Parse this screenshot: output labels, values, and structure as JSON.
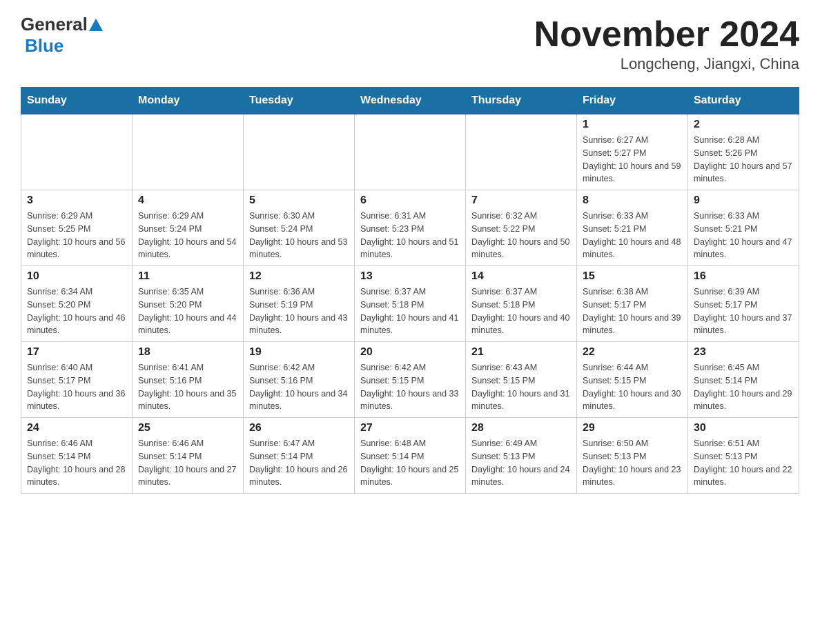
{
  "header": {
    "logo_general": "General",
    "logo_blue": "Blue",
    "month_title": "November 2024",
    "location": "Longcheng, Jiangxi, China"
  },
  "weekdays": [
    "Sunday",
    "Monday",
    "Tuesday",
    "Wednesday",
    "Thursday",
    "Friday",
    "Saturday"
  ],
  "weeks": [
    [
      {
        "day": "",
        "sunrise": "",
        "sunset": "",
        "daylight": ""
      },
      {
        "day": "",
        "sunrise": "",
        "sunset": "",
        "daylight": ""
      },
      {
        "day": "",
        "sunrise": "",
        "sunset": "",
        "daylight": ""
      },
      {
        "day": "",
        "sunrise": "",
        "sunset": "",
        "daylight": ""
      },
      {
        "day": "",
        "sunrise": "",
        "sunset": "",
        "daylight": ""
      },
      {
        "day": "1",
        "sunrise": "Sunrise: 6:27 AM",
        "sunset": "Sunset: 5:27 PM",
        "daylight": "Daylight: 10 hours and 59 minutes."
      },
      {
        "day": "2",
        "sunrise": "Sunrise: 6:28 AM",
        "sunset": "Sunset: 5:26 PM",
        "daylight": "Daylight: 10 hours and 57 minutes."
      }
    ],
    [
      {
        "day": "3",
        "sunrise": "Sunrise: 6:29 AM",
        "sunset": "Sunset: 5:25 PM",
        "daylight": "Daylight: 10 hours and 56 minutes."
      },
      {
        "day": "4",
        "sunrise": "Sunrise: 6:29 AM",
        "sunset": "Sunset: 5:24 PM",
        "daylight": "Daylight: 10 hours and 54 minutes."
      },
      {
        "day": "5",
        "sunrise": "Sunrise: 6:30 AM",
        "sunset": "Sunset: 5:24 PM",
        "daylight": "Daylight: 10 hours and 53 minutes."
      },
      {
        "day": "6",
        "sunrise": "Sunrise: 6:31 AM",
        "sunset": "Sunset: 5:23 PM",
        "daylight": "Daylight: 10 hours and 51 minutes."
      },
      {
        "day": "7",
        "sunrise": "Sunrise: 6:32 AM",
        "sunset": "Sunset: 5:22 PM",
        "daylight": "Daylight: 10 hours and 50 minutes."
      },
      {
        "day": "8",
        "sunrise": "Sunrise: 6:33 AM",
        "sunset": "Sunset: 5:21 PM",
        "daylight": "Daylight: 10 hours and 48 minutes."
      },
      {
        "day": "9",
        "sunrise": "Sunrise: 6:33 AM",
        "sunset": "Sunset: 5:21 PM",
        "daylight": "Daylight: 10 hours and 47 minutes."
      }
    ],
    [
      {
        "day": "10",
        "sunrise": "Sunrise: 6:34 AM",
        "sunset": "Sunset: 5:20 PM",
        "daylight": "Daylight: 10 hours and 46 minutes."
      },
      {
        "day": "11",
        "sunrise": "Sunrise: 6:35 AM",
        "sunset": "Sunset: 5:20 PM",
        "daylight": "Daylight: 10 hours and 44 minutes."
      },
      {
        "day": "12",
        "sunrise": "Sunrise: 6:36 AM",
        "sunset": "Sunset: 5:19 PM",
        "daylight": "Daylight: 10 hours and 43 minutes."
      },
      {
        "day": "13",
        "sunrise": "Sunrise: 6:37 AM",
        "sunset": "Sunset: 5:18 PM",
        "daylight": "Daylight: 10 hours and 41 minutes."
      },
      {
        "day": "14",
        "sunrise": "Sunrise: 6:37 AM",
        "sunset": "Sunset: 5:18 PM",
        "daylight": "Daylight: 10 hours and 40 minutes."
      },
      {
        "day": "15",
        "sunrise": "Sunrise: 6:38 AM",
        "sunset": "Sunset: 5:17 PM",
        "daylight": "Daylight: 10 hours and 39 minutes."
      },
      {
        "day": "16",
        "sunrise": "Sunrise: 6:39 AM",
        "sunset": "Sunset: 5:17 PM",
        "daylight": "Daylight: 10 hours and 37 minutes."
      }
    ],
    [
      {
        "day": "17",
        "sunrise": "Sunrise: 6:40 AM",
        "sunset": "Sunset: 5:17 PM",
        "daylight": "Daylight: 10 hours and 36 minutes."
      },
      {
        "day": "18",
        "sunrise": "Sunrise: 6:41 AM",
        "sunset": "Sunset: 5:16 PM",
        "daylight": "Daylight: 10 hours and 35 minutes."
      },
      {
        "day": "19",
        "sunrise": "Sunrise: 6:42 AM",
        "sunset": "Sunset: 5:16 PM",
        "daylight": "Daylight: 10 hours and 34 minutes."
      },
      {
        "day": "20",
        "sunrise": "Sunrise: 6:42 AM",
        "sunset": "Sunset: 5:15 PM",
        "daylight": "Daylight: 10 hours and 33 minutes."
      },
      {
        "day": "21",
        "sunrise": "Sunrise: 6:43 AM",
        "sunset": "Sunset: 5:15 PM",
        "daylight": "Daylight: 10 hours and 31 minutes."
      },
      {
        "day": "22",
        "sunrise": "Sunrise: 6:44 AM",
        "sunset": "Sunset: 5:15 PM",
        "daylight": "Daylight: 10 hours and 30 minutes."
      },
      {
        "day": "23",
        "sunrise": "Sunrise: 6:45 AM",
        "sunset": "Sunset: 5:14 PM",
        "daylight": "Daylight: 10 hours and 29 minutes."
      }
    ],
    [
      {
        "day": "24",
        "sunrise": "Sunrise: 6:46 AM",
        "sunset": "Sunset: 5:14 PM",
        "daylight": "Daylight: 10 hours and 28 minutes."
      },
      {
        "day": "25",
        "sunrise": "Sunrise: 6:46 AM",
        "sunset": "Sunset: 5:14 PM",
        "daylight": "Daylight: 10 hours and 27 minutes."
      },
      {
        "day": "26",
        "sunrise": "Sunrise: 6:47 AM",
        "sunset": "Sunset: 5:14 PM",
        "daylight": "Daylight: 10 hours and 26 minutes."
      },
      {
        "day": "27",
        "sunrise": "Sunrise: 6:48 AM",
        "sunset": "Sunset: 5:14 PM",
        "daylight": "Daylight: 10 hours and 25 minutes."
      },
      {
        "day": "28",
        "sunrise": "Sunrise: 6:49 AM",
        "sunset": "Sunset: 5:13 PM",
        "daylight": "Daylight: 10 hours and 24 minutes."
      },
      {
        "day": "29",
        "sunrise": "Sunrise: 6:50 AM",
        "sunset": "Sunset: 5:13 PM",
        "daylight": "Daylight: 10 hours and 23 minutes."
      },
      {
        "day": "30",
        "sunrise": "Sunrise: 6:51 AM",
        "sunset": "Sunset: 5:13 PM",
        "daylight": "Daylight: 10 hours and 22 minutes."
      }
    ]
  ]
}
